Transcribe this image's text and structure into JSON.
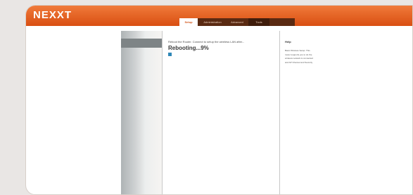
{
  "brand": {
    "logo_text": "NEXXT"
  },
  "tabs": [
    {
      "label": "Setup",
      "active": true
    },
    {
      "label": "Administration",
      "active": false
    },
    {
      "label": "Advanced",
      "active": false
    },
    {
      "label": "Tools",
      "active": false
    }
  ],
  "main": {
    "status_line": "Reboot the Router. Connect to setup the wireless LAN after...",
    "progress_label": "Rebooting...9%"
  },
  "help": {
    "title": "Help",
    "body_bold": "Basic Wireless Setup:",
    "body_rest": "This router can use a wireless or cable...",
    "lines": [
      "Basic Wireless Setup: This",
      "router supports you to do the",
      "wireless network is connected",
      "and AP Channel and Security"
    ]
  },
  "colors": {
    "accent": "#e0621f",
    "tab_bar": "#5a2a12",
    "spinner": "#2f87b7"
  }
}
